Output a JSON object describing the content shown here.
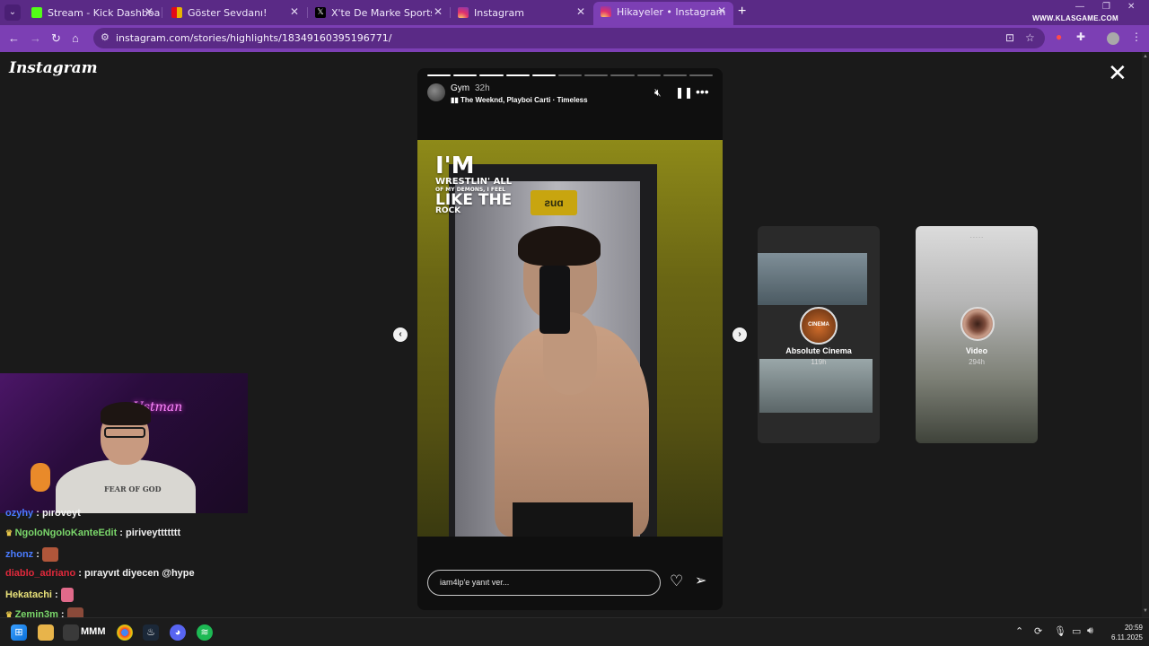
{
  "browser": {
    "tabs": [
      {
        "title": "Stream - Kick Dashboard",
        "favicon_color": "#53fc18"
      },
      {
        "title": "Göster Sevdanı!",
        "favicon_color": "#e8b400"
      },
      {
        "title": "X'te De Marke Sports: \"SON DA",
        "favicon_color": "#000000"
      },
      {
        "title": "Instagram",
        "favicon_color": "#e1306c"
      },
      {
        "title": "Hikayeler • Instagram",
        "favicon_color": "#e1306c"
      }
    ],
    "active_tab": 4,
    "url": "instagram.com/stories/highlights/18349160395196771/",
    "watermark": "WWW.KLASGAME.COM",
    "accent_color": "#7c3fb4"
  },
  "instagram": {
    "logo": "Instagram",
    "story": {
      "username": "Gym",
      "time": "32h",
      "music": "The Weeknd, Playboi Carti · Timeless",
      "progress_total": 11,
      "progress_done": 5,
      "overlay_text": {
        "line1": "I'M",
        "line2": "WRESTLIN' ALL",
        "line3": "OF MY DEMONS, I FEEL",
        "line4": "LIKE THE",
        "line5": "ROCK"
      },
      "door_sign": "ƨuɑ",
      "reply_placeholder": "iam4lp'e yanıt ver..."
    },
    "previews": [
      {
        "name": "Absolute Cinema",
        "time": "119h",
        "avatar_label": "CINEMA"
      },
      {
        "name": "Video",
        "time": "294h"
      }
    ]
  },
  "webcam": {
    "neon_sign": "Ustman",
    "hoodie_text": "FEAR OF GOD"
  },
  "chat": [
    {
      "user": "ozyhy",
      "message": "pıroveyt",
      "color": "#4a7cff",
      "badge": false
    },
    {
      "user": "NgoloNgoloKanteEdit",
      "message": "piriveyttttttt",
      "color": "#7bd86b",
      "badge": true
    },
    {
      "user": "zhonz",
      "message": "",
      "color": "#4a7cff",
      "emote": true
    },
    {
      "user": "diablo_adriano",
      "message": "pırayvıt diyecen @hype",
      "color": "#e0293b",
      "badge": false
    },
    {
      "user": "Hekatachi",
      "message": "",
      "color": "#e9e27a",
      "emote": true
    },
    {
      "user": "Zemin3m",
      "message": "",
      "color": "#7bd86b",
      "badge": true,
      "emote": true
    }
  ],
  "taskbar": {
    "overlay_label": "MMM",
    "time": "20:59",
    "date": "6.11.2025"
  }
}
